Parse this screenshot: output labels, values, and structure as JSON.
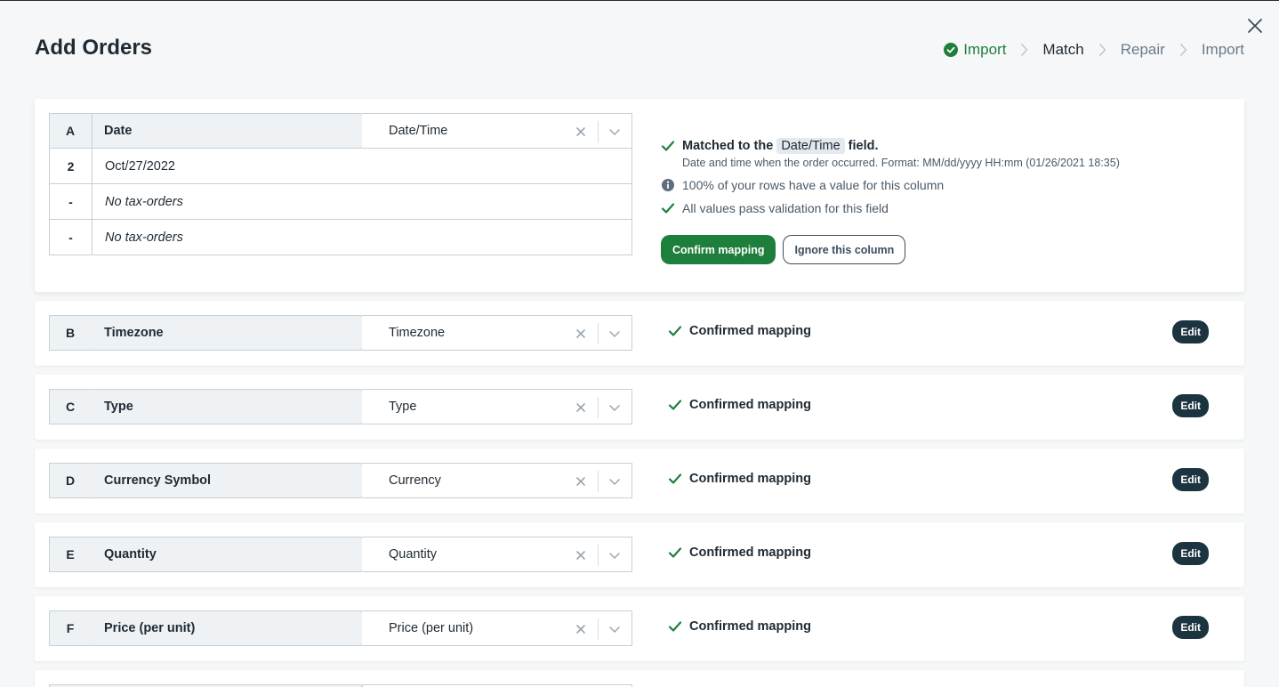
{
  "dialog": {
    "title": "Add Orders"
  },
  "steps": [
    {
      "label": "Import",
      "state": "done"
    },
    {
      "label": "Match",
      "state": "current"
    },
    {
      "label": "Repair",
      "state": "upcoming"
    },
    {
      "label": "Import",
      "state": "upcoming"
    }
  ],
  "expanded": {
    "letter": "A",
    "column_name": "Date",
    "selected_field": "Date/Time",
    "rows": [
      {
        "index": "2",
        "value": "Oct/27/2022",
        "italic": false
      },
      {
        "index": "-",
        "value": "No tax-orders",
        "italic": true
      },
      {
        "index": "-",
        "value": "No tax-orders",
        "italic": true
      }
    ],
    "match_prefix": "Matched to the",
    "match_field": "Date/Time",
    "match_suffix": "field.",
    "match_description": "Date and time when the order occurred. Format: MM/dd/yyyy HH:mm (01/26/2021 18:35)",
    "coverage_text": "100% of your rows have a value for this column",
    "validation_text": "All values pass validation for this field",
    "confirm_label": "Confirm mapping",
    "ignore_label": "Ignore this column"
  },
  "mappings": [
    {
      "letter": "B",
      "column_name": "Timezone",
      "selected_field": "Timezone",
      "status": "Confirmed mapping",
      "edit_label": "Edit"
    },
    {
      "letter": "C",
      "column_name": "Type",
      "selected_field": "Type",
      "status": "Confirmed mapping",
      "edit_label": "Edit"
    },
    {
      "letter": "D",
      "column_name": "Currency Symbol",
      "selected_field": "Currency",
      "status": "Confirmed mapping",
      "edit_label": "Edit"
    },
    {
      "letter": "E",
      "column_name": "Quantity",
      "selected_field": "Quantity",
      "status": "Confirmed mapping",
      "edit_label": "Edit"
    },
    {
      "letter": "F",
      "column_name": "Price (per unit)",
      "selected_field": "Price (per unit)",
      "status": "Confirmed mapping",
      "edit_label": "Edit"
    }
  ],
  "colors": {
    "accent_green": "#1e7f3c",
    "edit_button": "#1c3340",
    "header_bg": "#eef2f5",
    "border": "#c5d0d8"
  },
  "icons": {
    "close": "close-icon",
    "step_done": "check-circle-icon",
    "step_separator": "chevron-right-icon",
    "check": "check-icon",
    "info": "info-icon",
    "clear": "clear-x-icon",
    "dropdown": "chevron-down-icon"
  }
}
